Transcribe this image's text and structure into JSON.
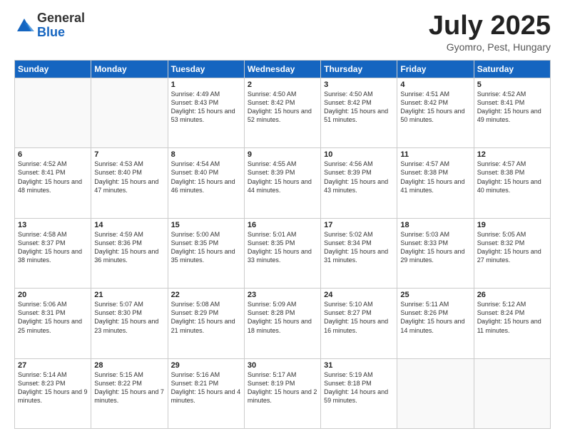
{
  "logo": {
    "general": "General",
    "blue": "Blue"
  },
  "header": {
    "month": "July 2025",
    "location": "Gyomro, Pest, Hungary"
  },
  "days": [
    "Sunday",
    "Monday",
    "Tuesday",
    "Wednesday",
    "Thursday",
    "Friday",
    "Saturday"
  ],
  "weeks": [
    [
      {
        "day": "",
        "sunrise": "",
        "sunset": "",
        "daylight": ""
      },
      {
        "day": "",
        "sunrise": "",
        "sunset": "",
        "daylight": ""
      },
      {
        "day": "1",
        "sunrise": "Sunrise: 4:49 AM",
        "sunset": "Sunset: 8:43 PM",
        "daylight": "Daylight: 15 hours and 53 minutes."
      },
      {
        "day": "2",
        "sunrise": "Sunrise: 4:50 AM",
        "sunset": "Sunset: 8:42 PM",
        "daylight": "Daylight: 15 hours and 52 minutes."
      },
      {
        "day": "3",
        "sunrise": "Sunrise: 4:50 AM",
        "sunset": "Sunset: 8:42 PM",
        "daylight": "Daylight: 15 hours and 51 minutes."
      },
      {
        "day": "4",
        "sunrise": "Sunrise: 4:51 AM",
        "sunset": "Sunset: 8:42 PM",
        "daylight": "Daylight: 15 hours and 50 minutes."
      },
      {
        "day": "5",
        "sunrise": "Sunrise: 4:52 AM",
        "sunset": "Sunset: 8:41 PM",
        "daylight": "Daylight: 15 hours and 49 minutes."
      }
    ],
    [
      {
        "day": "6",
        "sunrise": "Sunrise: 4:52 AM",
        "sunset": "Sunset: 8:41 PM",
        "daylight": "Daylight: 15 hours and 48 minutes."
      },
      {
        "day": "7",
        "sunrise": "Sunrise: 4:53 AM",
        "sunset": "Sunset: 8:40 PM",
        "daylight": "Daylight: 15 hours and 47 minutes."
      },
      {
        "day": "8",
        "sunrise": "Sunrise: 4:54 AM",
        "sunset": "Sunset: 8:40 PM",
        "daylight": "Daylight: 15 hours and 46 minutes."
      },
      {
        "day": "9",
        "sunrise": "Sunrise: 4:55 AM",
        "sunset": "Sunset: 8:39 PM",
        "daylight": "Daylight: 15 hours and 44 minutes."
      },
      {
        "day": "10",
        "sunrise": "Sunrise: 4:56 AM",
        "sunset": "Sunset: 8:39 PM",
        "daylight": "Daylight: 15 hours and 43 minutes."
      },
      {
        "day": "11",
        "sunrise": "Sunrise: 4:57 AM",
        "sunset": "Sunset: 8:38 PM",
        "daylight": "Daylight: 15 hours and 41 minutes."
      },
      {
        "day": "12",
        "sunrise": "Sunrise: 4:57 AM",
        "sunset": "Sunset: 8:38 PM",
        "daylight": "Daylight: 15 hours and 40 minutes."
      }
    ],
    [
      {
        "day": "13",
        "sunrise": "Sunrise: 4:58 AM",
        "sunset": "Sunset: 8:37 PM",
        "daylight": "Daylight: 15 hours and 38 minutes."
      },
      {
        "day": "14",
        "sunrise": "Sunrise: 4:59 AM",
        "sunset": "Sunset: 8:36 PM",
        "daylight": "Daylight: 15 hours and 36 minutes."
      },
      {
        "day": "15",
        "sunrise": "Sunrise: 5:00 AM",
        "sunset": "Sunset: 8:35 PM",
        "daylight": "Daylight: 15 hours and 35 minutes."
      },
      {
        "day": "16",
        "sunrise": "Sunrise: 5:01 AM",
        "sunset": "Sunset: 8:35 PM",
        "daylight": "Daylight: 15 hours and 33 minutes."
      },
      {
        "day": "17",
        "sunrise": "Sunrise: 5:02 AM",
        "sunset": "Sunset: 8:34 PM",
        "daylight": "Daylight: 15 hours and 31 minutes."
      },
      {
        "day": "18",
        "sunrise": "Sunrise: 5:03 AM",
        "sunset": "Sunset: 8:33 PM",
        "daylight": "Daylight: 15 hours and 29 minutes."
      },
      {
        "day": "19",
        "sunrise": "Sunrise: 5:05 AM",
        "sunset": "Sunset: 8:32 PM",
        "daylight": "Daylight: 15 hours and 27 minutes."
      }
    ],
    [
      {
        "day": "20",
        "sunrise": "Sunrise: 5:06 AM",
        "sunset": "Sunset: 8:31 PM",
        "daylight": "Daylight: 15 hours and 25 minutes."
      },
      {
        "day": "21",
        "sunrise": "Sunrise: 5:07 AM",
        "sunset": "Sunset: 8:30 PM",
        "daylight": "Daylight: 15 hours and 23 minutes."
      },
      {
        "day": "22",
        "sunrise": "Sunrise: 5:08 AM",
        "sunset": "Sunset: 8:29 PM",
        "daylight": "Daylight: 15 hours and 21 minutes."
      },
      {
        "day": "23",
        "sunrise": "Sunrise: 5:09 AM",
        "sunset": "Sunset: 8:28 PM",
        "daylight": "Daylight: 15 hours and 18 minutes."
      },
      {
        "day": "24",
        "sunrise": "Sunrise: 5:10 AM",
        "sunset": "Sunset: 8:27 PM",
        "daylight": "Daylight: 15 hours and 16 minutes."
      },
      {
        "day": "25",
        "sunrise": "Sunrise: 5:11 AM",
        "sunset": "Sunset: 8:26 PM",
        "daylight": "Daylight: 15 hours and 14 minutes."
      },
      {
        "day": "26",
        "sunrise": "Sunrise: 5:12 AM",
        "sunset": "Sunset: 8:24 PM",
        "daylight": "Daylight: 15 hours and 11 minutes."
      }
    ],
    [
      {
        "day": "27",
        "sunrise": "Sunrise: 5:14 AM",
        "sunset": "Sunset: 8:23 PM",
        "daylight": "Daylight: 15 hours and 9 minutes."
      },
      {
        "day": "28",
        "sunrise": "Sunrise: 5:15 AM",
        "sunset": "Sunset: 8:22 PM",
        "daylight": "Daylight: 15 hours and 7 minutes."
      },
      {
        "day": "29",
        "sunrise": "Sunrise: 5:16 AM",
        "sunset": "Sunset: 8:21 PM",
        "daylight": "Daylight: 15 hours and 4 minutes."
      },
      {
        "day": "30",
        "sunrise": "Sunrise: 5:17 AM",
        "sunset": "Sunset: 8:19 PM",
        "daylight": "Daylight: 15 hours and 2 minutes."
      },
      {
        "day": "31",
        "sunrise": "Sunrise: 5:19 AM",
        "sunset": "Sunset: 8:18 PM",
        "daylight": "Daylight: 14 hours and 59 minutes."
      },
      {
        "day": "",
        "sunrise": "",
        "sunset": "",
        "daylight": ""
      },
      {
        "day": "",
        "sunrise": "",
        "sunset": "",
        "daylight": ""
      }
    ]
  ]
}
